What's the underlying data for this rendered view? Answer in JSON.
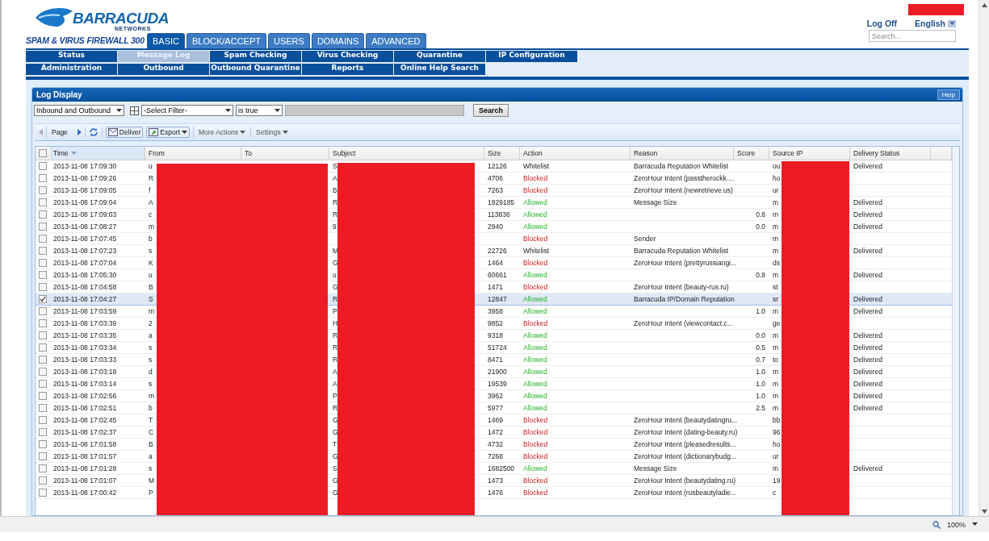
{
  "header": {
    "logo": {
      "name": "BARRACUDA",
      "sub": "NETWORKS"
    },
    "product": "SPAM & VIRUS FIREWALL 300",
    "log_off": "Log Off",
    "language": "English",
    "search": {
      "placeholder": "Search..."
    }
  },
  "tabs": [
    {
      "label": "BASIC",
      "selected": true
    },
    {
      "label": "BLOCK/ACCEPT",
      "selected": false
    },
    {
      "label": "USERS",
      "selected": false
    },
    {
      "label": "DOMAINS",
      "selected": false
    },
    {
      "label": "ADVANCED",
      "selected": false
    }
  ],
  "subnav": [
    [
      {
        "label": "Status",
        "selected": false
      },
      {
        "label": "Message Log",
        "selected": true
      },
      {
        "label": "Spam Checking",
        "selected": false
      },
      {
        "label": "Virus Checking",
        "selected": false
      },
      {
        "label": "Quarantine",
        "selected": false
      },
      {
        "label": "IP Configuration",
        "selected": false
      }
    ],
    [
      {
        "label": "Administration",
        "selected": false
      },
      {
        "label": "Outbound",
        "selected": false
      },
      {
        "label": "Outbound Quarantine",
        "selected": false
      },
      {
        "label": "Reports",
        "selected": false
      },
      {
        "label": "Online Help Search",
        "selected": false
      }
    ]
  ],
  "panel": {
    "title": "Log Display",
    "help": "Help"
  },
  "filter": {
    "direction": "Inbound and Outbound",
    "field": "-Select Filter-",
    "condition": "is true",
    "search_button": "Search"
  },
  "toolbar": {
    "page": "Page",
    "deliver": "Deliver",
    "export": "Export",
    "more_actions": "More Actions",
    "settings": "Settings"
  },
  "table": {
    "select_all": {
      "checked": false
    },
    "columns": [
      {
        "label": "Time",
        "sorted": true
      },
      {
        "label": "From",
        "sorted": false
      },
      {
        "label": "To",
        "sorted": false
      },
      {
        "label": "Subject",
        "sorted": false
      },
      {
        "label": "Size",
        "sorted": false
      },
      {
        "label": "Action",
        "sorted": false
      },
      {
        "label": "Reason",
        "sorted": false
      },
      {
        "label": "Score",
        "sorted": false
      },
      {
        "label": "Source IP",
        "sorted": false
      },
      {
        "label": "Delivery Status",
        "sorted": false
      }
    ],
    "rows": [
      {
        "selected": false,
        "time": "2013-11-08 17:09:30",
        "from": "u",
        "subject": "S",
        "size": "12126",
        "action": "Whitelist",
        "kind": "whitelist",
        "reason": "Barracuda Reputation Whitelist",
        "source_ip": "ou",
        "delivery": "Delivered"
      },
      {
        "selected": false,
        "time": "2013-11-08 17:09:26",
        "from": "R",
        "subject": "A",
        "size": "4706",
        "action": "Blocked",
        "kind": "blocked",
        "reason": "ZeroHour Intent (passtherockk....",
        "source_ip": "ho"
      },
      {
        "selected": false,
        "time": "2013-11-08 17:09:05",
        "from": "f",
        "subject": "B",
        "size": "7263",
        "action": "Blocked",
        "kind": "blocked",
        "reason": "ZeroHour Intent (newretrieve.us)",
        "source_ip": "ur"
      },
      {
        "selected": false,
        "time": "2013-11-08 17:09:04",
        "from": "A",
        "subject": "R",
        "size": "1929185",
        "action": "Allowed",
        "kind": "allowed",
        "reason": "Message Size",
        "source_ip": "m",
        "delivery": "Delivered"
      },
      {
        "selected": false,
        "time": "2013-11-08 17:09:03",
        "from": "c",
        "subject": "R",
        "size": "113836",
        "action": "Allowed",
        "kind": "allowed",
        "score": "0.8",
        "source_ip": "m",
        "delivery": "Delivered"
      },
      {
        "selected": false,
        "time": "2013-11-08 17:08:27",
        "from": "m",
        "subject": "9",
        "size": "2940",
        "action": "Allowed",
        "kind": "allowed",
        "score": "0.0",
        "source_ip": "m",
        "delivery": "Delivered"
      },
      {
        "selected": false,
        "time": "2013-11-08 17:07:45",
        "from": "b",
        "action": "Blocked",
        "kind": "blocked",
        "reason": "Sender",
        "source_ip": "m"
      },
      {
        "selected": false,
        "time": "2013-11-08 17:07:23",
        "from": "s",
        "subject": "M",
        "size": "22726",
        "action": "Whitelist",
        "kind": "whitelist",
        "reason": "Barracuda Reputation Whitelist",
        "source_ip": "m",
        "delivery": "Delivered"
      },
      {
        "selected": false,
        "time": "2013-11-08 17:07:04",
        "from": "K",
        "subject": "G",
        "size": "1464",
        "action": "Blocked",
        "kind": "blocked",
        "reason": "ZeroHour Intent (prettyrussiangi...",
        "source_ip": "ds"
      },
      {
        "selected": false,
        "time": "2013-11-08 17:05:30",
        "from": "u",
        "subject": "u",
        "size": "60661",
        "action": "Allowed",
        "kind": "allowed",
        "score": "0.8",
        "source_ip": "m",
        "delivery": "Delivered"
      },
      {
        "selected": false,
        "time": "2013-11-08 17:04:58",
        "from": "B",
        "subject": "G",
        "size": "1471",
        "action": "Blocked",
        "kind": "blocked",
        "reason": "ZeroHour Intent (beauty-rus.ru)",
        "source_ip": "st"
      },
      {
        "selected": true,
        "time": "2013-11-08 17:04:27",
        "from": "S",
        "subject": "R",
        "size": "12847",
        "action": "Allowed",
        "kind": "allowed",
        "reason": "Barracuda IP/Domain Reputation",
        "source_ip": "sr",
        "delivery": "Delivered"
      },
      {
        "selected": false,
        "time": "2013-11-08 17:03:59",
        "from": "m",
        "subject": "P",
        "size": "3958",
        "action": "Allowed",
        "kind": "allowed",
        "score": "1.0",
        "source_ip": "m",
        "delivery": "Delivered"
      },
      {
        "selected": false,
        "time": "2013-11-08 17:03:39",
        "from": "2",
        "subject": "H",
        "size": "9852",
        "action": "Blocked",
        "kind": "blocked",
        "reason": "ZeroHour Intent (viewcontact.c...",
        "source_ip": "ge"
      },
      {
        "selected": false,
        "time": "2013-11-08 17:03:35",
        "from": "a",
        "subject": "R",
        "size": "9318",
        "action": "Allowed",
        "kind": "allowed",
        "score": "0.0",
        "source_ip": "m",
        "delivery": "Delivered"
      },
      {
        "selected": false,
        "time": "2013-11-08 17:03:34",
        "from": "s",
        "subject": "R",
        "size": "51724",
        "action": "Allowed",
        "kind": "allowed",
        "score": "0.5",
        "source_ip": "m",
        "delivery": "Delivered"
      },
      {
        "selected": false,
        "time": "2013-11-08 17:03:33",
        "from": "s",
        "subject": "R",
        "size": "8471",
        "action": "Allowed",
        "kind": "allowed",
        "score": "0.7",
        "source_ip": "to",
        "delivery": "Delivered"
      },
      {
        "selected": false,
        "time": "2013-11-08 17:03:18",
        "from": "d",
        "subject": "A",
        "size": "21900",
        "action": "Allowed",
        "kind": "allowed",
        "score": "1.0",
        "source_ip": "m",
        "delivery": "Delivered"
      },
      {
        "selected": false,
        "time": "2013-11-08 17:03:14",
        "from": "s",
        "subject": "A",
        "size": "19539",
        "action": "Allowed",
        "kind": "allowed",
        "score": "1.0",
        "source_ip": "m",
        "delivery": "Delivered"
      },
      {
        "selected": false,
        "time": "2013-11-08 17:02:56",
        "from": "m",
        "subject": "P",
        "size": "3962",
        "action": "Allowed",
        "kind": "allowed",
        "score": "1.0",
        "source_ip": "m",
        "delivery": "Delivered"
      },
      {
        "selected": false,
        "time": "2013-11-08 17:02:51",
        "from": "b",
        "subject": "R",
        "size": "5977",
        "action": "Allowed",
        "kind": "allowed",
        "score": "2.5",
        "source_ip": "m",
        "delivery": "Delivered"
      },
      {
        "selected": false,
        "time": "2013-11-08 17:02:45",
        "from": "T",
        "subject": "G",
        "size": "1469",
        "action": "Blocked",
        "kind": "blocked",
        "reason": "ZeroHour Intent (beautydatingru...",
        "source_ip": "bb"
      },
      {
        "selected": false,
        "time": "2013-11-08 17:02:37",
        "from": "C",
        "subject": "G",
        "size": "1472",
        "action": "Blocked",
        "kind": "blocked",
        "reason": "ZeroHour Intent (dating-beauty.ru)",
        "source_ip": "96"
      },
      {
        "selected": false,
        "time": "2013-11-08 17:01:58",
        "from": "B",
        "subject": "T",
        "size": "4732",
        "action": "Blocked",
        "kind": "blocked",
        "reason": "ZeroHour Intent (pleasedresults...",
        "source_ip": "ho"
      },
      {
        "selected": false,
        "time": "2013-11-08 17:01:57",
        "from": "a",
        "subject": "G",
        "size": "7268",
        "action": "Blocked",
        "kind": "blocked",
        "reason": "ZeroHour Intent (dictionarybudg...",
        "source_ip": "ur"
      },
      {
        "selected": false,
        "time": "2013-11-08 17:01:28",
        "from": "s",
        "subject": "S",
        "size": "1682500",
        "action": "Allowed",
        "kind": "allowed",
        "reason": "Message Size",
        "source_ip": "m",
        "delivery": "Delivered"
      },
      {
        "selected": false,
        "time": "2013-11-08 17:01:07",
        "from": "M",
        "subject": "G",
        "size": "1473",
        "action": "Blocked",
        "kind": "blocked",
        "reason": "ZeroHour Intent (beautydating.ru)",
        "source_ip": "19"
      },
      {
        "selected": false,
        "time": "2013-11-08 17:00:42",
        "from": "P",
        "subject": "G",
        "size": "1476",
        "action": "Blocked",
        "kind": "blocked",
        "reason": "ZeroHour Intent (rusbeautyladie...",
        "source_ip": "c"
      }
    ]
  },
  "status_bar": {
    "zoom": "100%"
  }
}
